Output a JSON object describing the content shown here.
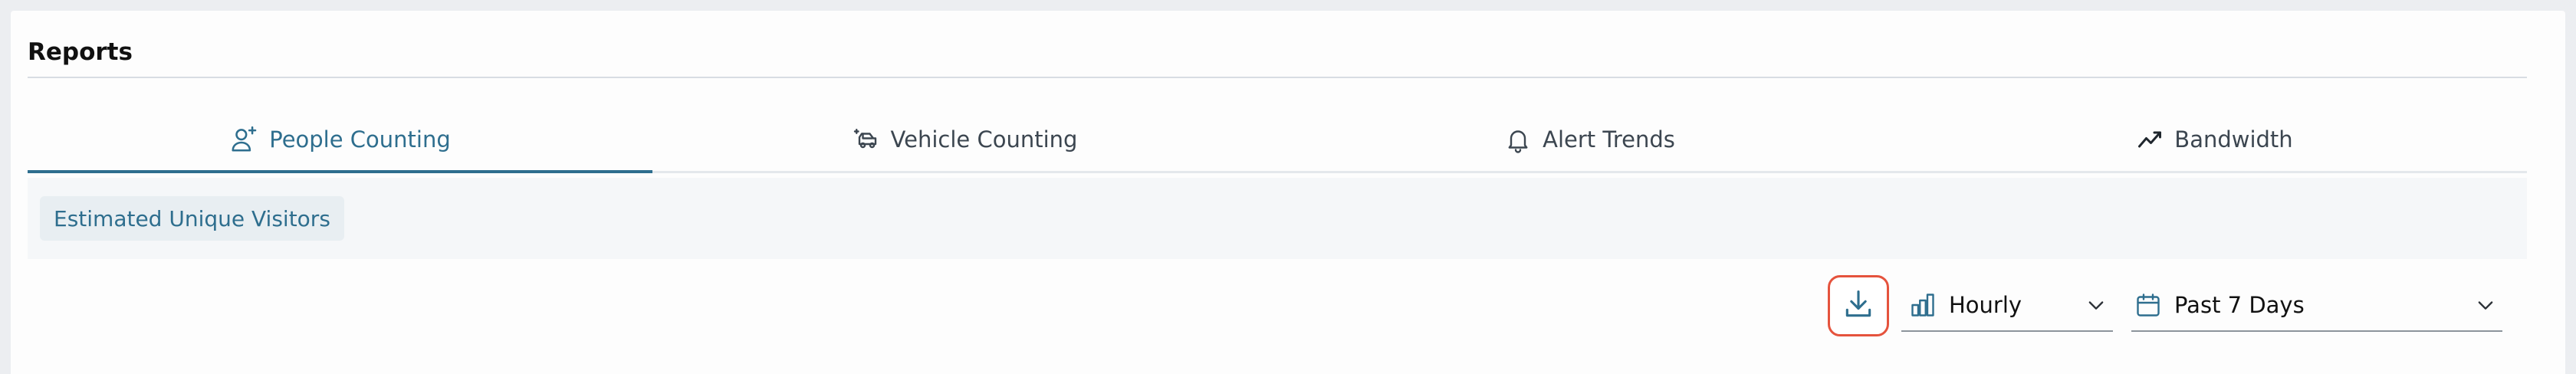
{
  "page": {
    "title": "Reports"
  },
  "tabs": [
    {
      "label": "People Counting",
      "icon": "person-add-icon",
      "active": true
    },
    {
      "label": "Vehicle Counting",
      "icon": "vehicle-icon",
      "active": false
    },
    {
      "label": "Alert Trends",
      "icon": "bell-icon",
      "active": false
    },
    {
      "label": "Bandwidth",
      "icon": "trend-line-icon",
      "active": false
    }
  ],
  "subtabs": [
    {
      "label": "Estimated Unique Visitors",
      "active": true
    }
  ],
  "controls": {
    "download": {
      "icon": "download-icon"
    },
    "interval": {
      "value": "Hourly",
      "icon": "bar-chart-icon"
    },
    "range": {
      "value": "Past 7 Days",
      "icon": "calendar-icon"
    }
  },
  "colors": {
    "accent": "#2e6e8e",
    "highlight_border": "#e5533d",
    "background": "#eceef1",
    "subbar": "#f5f7f9"
  }
}
